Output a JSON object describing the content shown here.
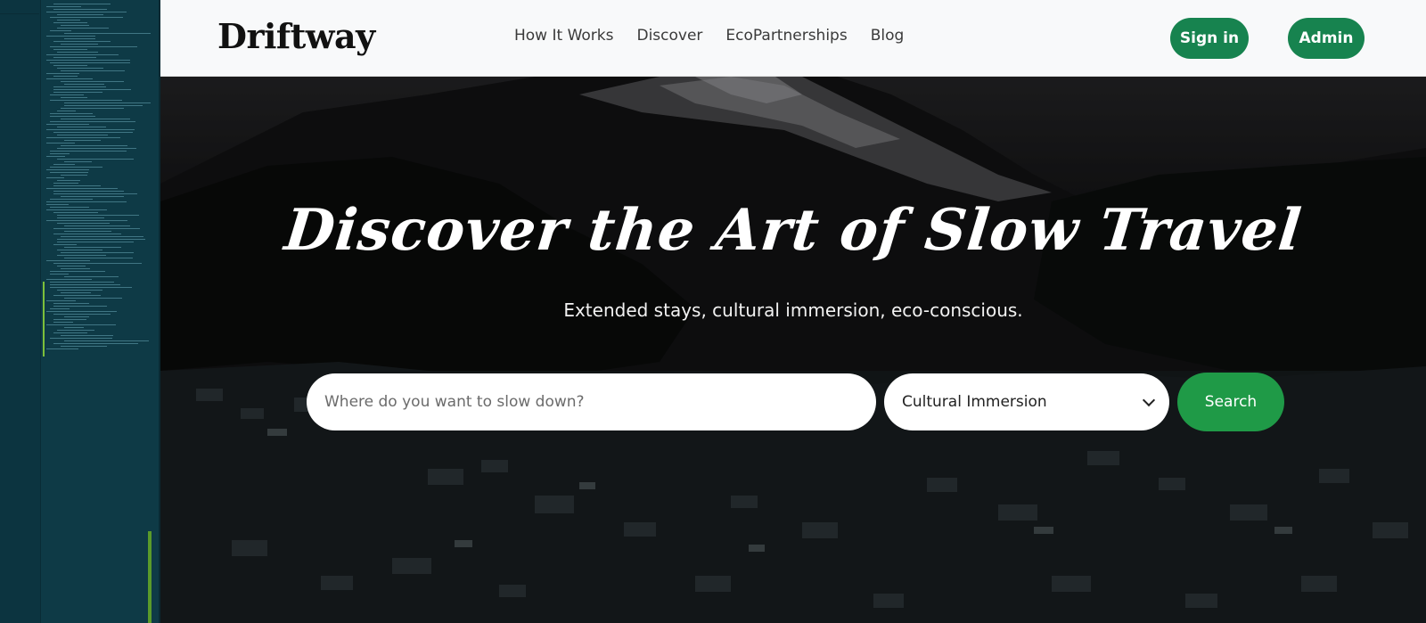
{
  "brand": {
    "name": "Driftway"
  },
  "nav": {
    "links": [
      {
        "label": "How It Works"
      },
      {
        "label": "Discover"
      },
      {
        "label": "EcoPartnerships"
      },
      {
        "label": "Blog"
      }
    ],
    "signin_label": "Sign in",
    "admin_label": "Admin"
  },
  "hero": {
    "title": "Discover the Art of Slow Travel",
    "subtitle": "Extended stays, cultural immersion, eco-conscious."
  },
  "search": {
    "placeholder": "Where do you want to slow down?",
    "value": "",
    "category_selected": "Cultural Immersion",
    "button_label": "Search"
  },
  "colors": {
    "accent_green": "#17834f",
    "search_green": "#1f9a47",
    "navbar_bg": "#f8f9fa",
    "editor_bg": "#0e3a46"
  },
  "icons": {
    "select_indicator": "chevron-down-icon"
  }
}
